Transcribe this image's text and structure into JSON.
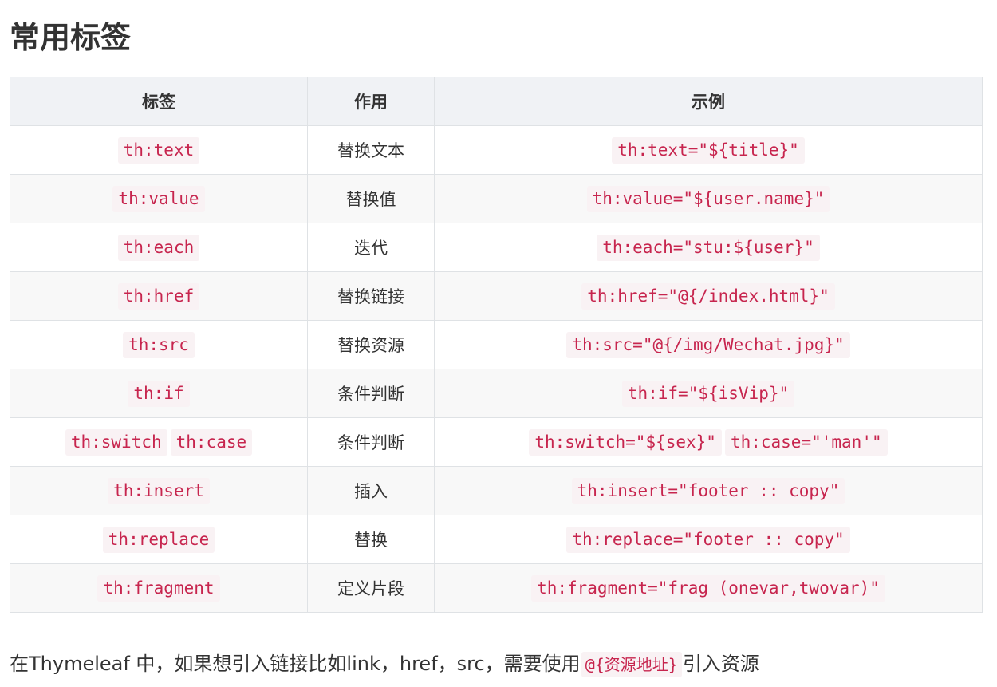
{
  "page": {
    "title": "常用标签"
  },
  "table": {
    "headers": [
      "标签",
      "作用",
      "示例"
    ],
    "rows": [
      {
        "tags": [
          "th:text"
        ],
        "desc": "替换文本",
        "examples": [
          "th:text=\"${title}\""
        ]
      },
      {
        "tags": [
          "th:value"
        ],
        "desc": "替换值",
        "examples": [
          "th:value=\"${user.name}\""
        ]
      },
      {
        "tags": [
          "th:each"
        ],
        "desc": "迭代",
        "examples": [
          "th:each=\"stu:${user}\""
        ]
      },
      {
        "tags": [
          "th:href"
        ],
        "desc": "替换链接",
        "examples": [
          "th:href=\"@{/index.html}\""
        ]
      },
      {
        "tags": [
          "th:src"
        ],
        "desc": "替换资源",
        "examples": [
          "th:src=\"@{/img/Wechat.jpg}\""
        ]
      },
      {
        "tags": [
          "th:if"
        ],
        "desc": "条件判断",
        "examples": [
          "th:if=\"${isVip}\""
        ]
      },
      {
        "tags": [
          "th:switch",
          "th:case"
        ],
        "desc": "条件判断",
        "examples": [
          "th:switch=\"${sex}\"",
          "th:case=\"'man'\""
        ]
      },
      {
        "tags": [
          "th:insert"
        ],
        "desc": "插入",
        "examples": [
          "th:insert=\"footer :: copy\""
        ]
      },
      {
        "tags": [
          "th:replace"
        ],
        "desc": "替换",
        "examples": [
          "th:replace=\"footer :: copy\""
        ]
      },
      {
        "tags": [
          "th:fragment"
        ],
        "desc": "定义片段",
        "examples": [
          "th:fragment=\"frag (onevar,twovar)\""
        ]
      }
    ]
  },
  "note": {
    "before": "在Thymeleaf 中，如果想引入链接比如link，href，src，需要使用",
    "code": "@{资源地址}",
    "after": "引入资源"
  },
  "colors": {
    "code_text": "#c7254e",
    "code_bg": "#f9f2f4",
    "header_bg": "#f0f2f5",
    "border": "#dfe2e5"
  }
}
